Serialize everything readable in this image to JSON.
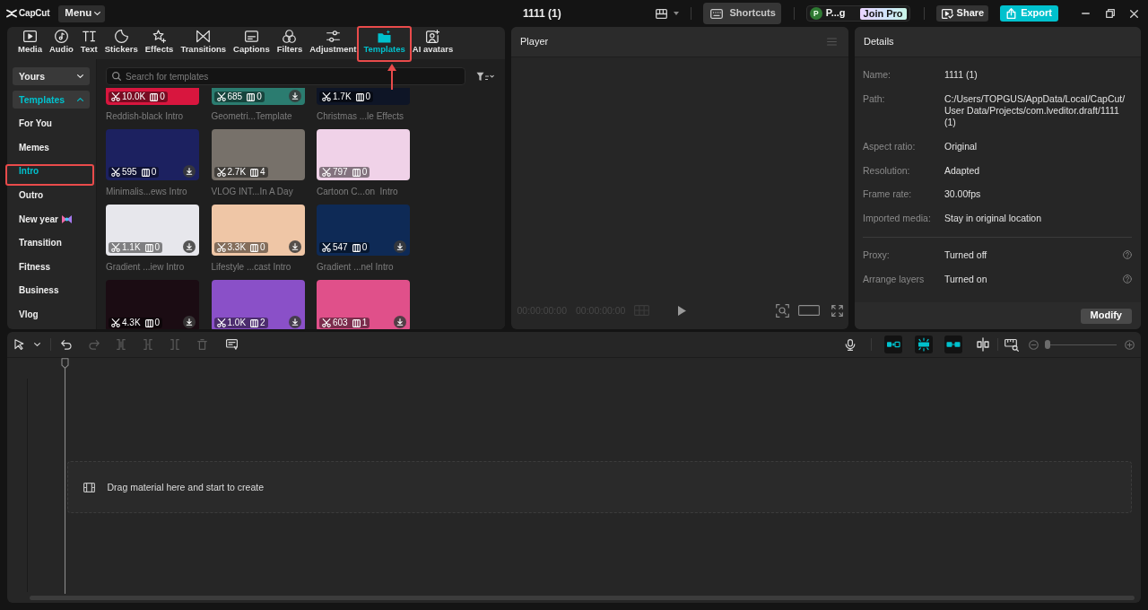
{
  "app": {
    "name": "CapCut",
    "menu": "Menu",
    "title": "1111 (1)"
  },
  "header_actions": {
    "shortcuts": "Shortcuts",
    "account_initial": "P",
    "account_name": "P...g",
    "pro": "Join Pro",
    "share": "Share",
    "export": "Export"
  },
  "tabs": [
    {
      "label": "Media",
      "selected": false,
      "highlighted": false
    },
    {
      "label": "Audio",
      "selected": false,
      "highlighted": false
    },
    {
      "label": "Text",
      "selected": false,
      "highlighted": false
    },
    {
      "label": "Stickers",
      "selected": false,
      "highlighted": false
    },
    {
      "label": "Effects",
      "selected": false,
      "highlighted": false
    },
    {
      "label": "Transitions",
      "selected": false,
      "highlighted": false
    },
    {
      "label": "Captions",
      "selected": false,
      "highlighted": false
    },
    {
      "label": "Filters",
      "selected": false,
      "highlighted": false
    },
    {
      "label": "Adjustment",
      "selected": false,
      "highlighted": false
    },
    {
      "label": "Templates",
      "selected": true,
      "highlighted": true
    },
    {
      "label": "AI avatars",
      "selected": false,
      "highlighted": false
    }
  ],
  "callout_arrow": true,
  "sidebar": [
    {
      "label": "Yours",
      "expanded": false,
      "selected": false
    },
    {
      "label": "Templates",
      "expanded": true,
      "selected": true,
      "children": [
        {
          "label": "For You",
          "selected": false,
          "highlighted": false,
          "emoji": false
        },
        {
          "label": "Memes",
          "selected": false,
          "highlighted": false,
          "emoji": false
        },
        {
          "label": "Intro",
          "selected": true,
          "highlighted": true,
          "emoji": false
        },
        {
          "label": "Outro",
          "selected": false,
          "highlighted": false,
          "emoji": false
        },
        {
          "label": "New year",
          "selected": false,
          "highlighted": false,
          "emoji": true
        },
        {
          "label": "Transition",
          "selected": false,
          "highlighted": false,
          "emoji": false
        },
        {
          "label": "Fitness",
          "selected": false,
          "highlighted": false,
          "emoji": false
        },
        {
          "label": "Business",
          "selected": false,
          "highlighted": false,
          "emoji": false
        },
        {
          "label": "Vlog",
          "selected": false,
          "highlighted": false,
          "emoji": false
        }
      ]
    }
  ],
  "search": {
    "placeholder": "Search for templates"
  },
  "templates": [
    {
      "title": "Reddish-black Intro",
      "uses": "10.0K",
      "clips": "0",
      "download": false,
      "color": "#d8163e"
    },
    {
      "title": "Geometri...Template",
      "uses": "685",
      "clips": "0",
      "download": true,
      "color": "#2b7c70"
    },
    {
      "title": "Christmas ...le Effects",
      "uses": "1.7K",
      "clips": "0",
      "download": false,
      "color": "#0e1526"
    },
    {
      "title": "Minimalis...ews Intro",
      "uses": "595",
      "clips": "0",
      "download": true,
      "color": "#1c2160"
    },
    {
      "title": "VLOG INT...In A Day",
      "uses": "2.7K",
      "clips": "4",
      "download": false,
      "color": "#77716a"
    },
    {
      "title": "Cartoon C...on  Intro",
      "uses": "797",
      "clips": "0",
      "download": false,
      "color": "#f0d2e8"
    },
    {
      "title": "Gradient ...iew Intro",
      "uses": "1.1K",
      "clips": "0",
      "download": true,
      "color": "#e7e7ec"
    },
    {
      "title": "Lifestyle ...cast Intro",
      "uses": "3.3K",
      "clips": "0",
      "download": true,
      "color": "#efc6a6"
    },
    {
      "title": "Gradient ...nel Intro",
      "uses": "547",
      "clips": "0",
      "download": true,
      "color": "#0e2a56"
    },
    {
      "uses": "4.3K",
      "clips": "0",
      "download": true,
      "color": "#1b0c13"
    },
    {
      "uses": "1.0K",
      "clips": "2",
      "download": true,
      "color": "#8a50c8"
    },
    {
      "uses": "603",
      "clips": "1",
      "download": true,
      "color": "#e0508a"
    }
  ],
  "player": {
    "title": "Player",
    "current_time": "00:00:00:00",
    "total_time": "00:00:00:00",
    "disabled": true
  },
  "details": {
    "title": "Details",
    "rows": [
      {
        "label": "Name:",
        "value": "1111 (1)"
      },
      {
        "label": "Path:",
        "value": "C:/Users/TOPGUS/AppData/Local/CapCut/User Data/Projects/com.lveditor.draft/1111 (1)"
      },
      {
        "label": "Aspect ratio:",
        "value": "Original"
      },
      {
        "label": "Resolution:",
        "value": "Adapted"
      },
      {
        "label": "Frame rate:",
        "value": "30.00fps"
      },
      {
        "label": "Imported media:",
        "value": "Stay in original location"
      }
    ],
    "settings": [
      {
        "label": "Proxy:",
        "value": "Turned off"
      },
      {
        "label": "Arrange layers",
        "value": "Turned on"
      }
    ],
    "button": "Modify"
  },
  "timeline": {
    "tools": [
      {
        "disabled": false
      },
      {
        "disabled": false
      },
      {
        "disabled": true
      },
      {
        "disabled": true
      },
      {
        "disabled": true
      },
      {
        "disabled": true
      },
      {
        "disabled": true
      },
      {
        "disabled": false
      }
    ],
    "toggles": [
      {
        "on": true
      },
      {
        "on": true
      },
      {
        "on": true
      },
      {
        "on": false
      }
    ],
    "zoom": {
      "level": 0
    },
    "hint": "Drag material here and start to create"
  }
}
